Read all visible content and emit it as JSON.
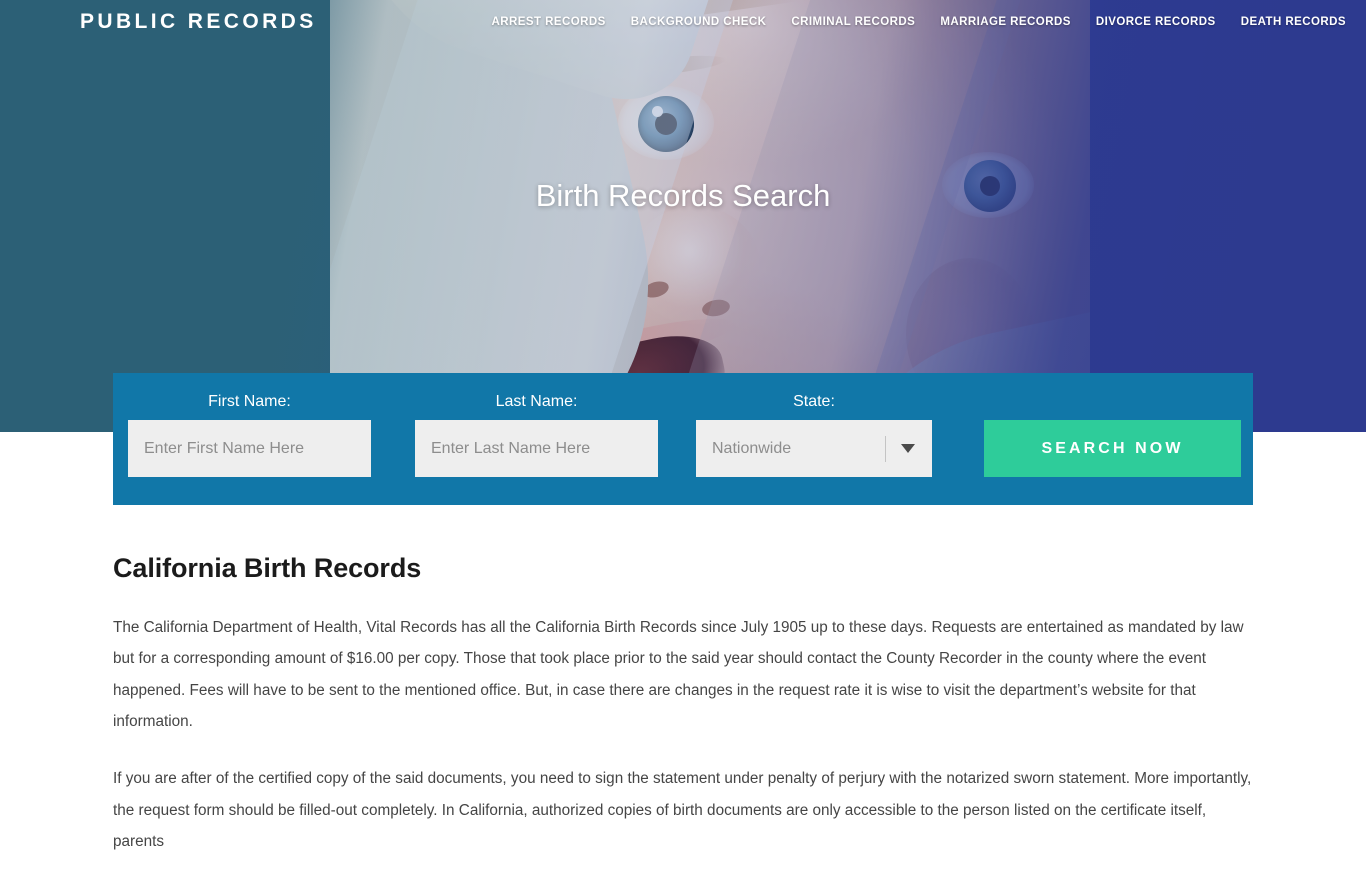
{
  "header": {
    "logo": "PUBLIC RECORDS",
    "nav": [
      {
        "label": "ARREST RECORDS"
      },
      {
        "label": "BACKGROUND CHECK"
      },
      {
        "label": "CRIMINAL RECORDS"
      },
      {
        "label": "MARRIAGE RECORDS"
      },
      {
        "label": "DIVORCE RECORDS"
      },
      {
        "label": "DEATH RECORDS"
      }
    ]
  },
  "hero": {
    "title": "Birth Records Search",
    "background_image": "close-up photo of a smiling baby wrapped in a white blanket",
    "gradient_left": "#2c6076",
    "gradient_right": "#2d3a8f"
  },
  "search": {
    "panel_color": "#1177a8",
    "first_name": {
      "label": "First Name:",
      "placeholder": "Enter First Name Here",
      "value": ""
    },
    "last_name": {
      "label": "Last Name:",
      "placeholder": "Enter Last Name Here",
      "value": ""
    },
    "state": {
      "label": "State:",
      "selected": "Nationwide"
    },
    "button": {
      "label": "SEARCH NOW",
      "color": "#2ecc9a"
    }
  },
  "content": {
    "heading": "California Birth Records",
    "paragraphs": [
      "The California Department of Health, Vital Records has all the California Birth Records since July 1905 up to these days. Requests are entertained as mandated by law but for a corresponding amount of $16.00 per copy. Those that took place prior to the said year should contact the County Recorder in the county where the event happened. Fees will have to be sent to the mentioned office. But, in case there are changes in the request rate it is wise to visit the department’s website for that information.",
      "If you are after of the certified copy of the said documents, you need to sign the statement under penalty of perjury with the notarized sworn statement. More importantly, the request form should be filled-out completely. In California, authorized copies of birth documents are only accessible to the person listed on the certificate itself, parents"
    ]
  }
}
